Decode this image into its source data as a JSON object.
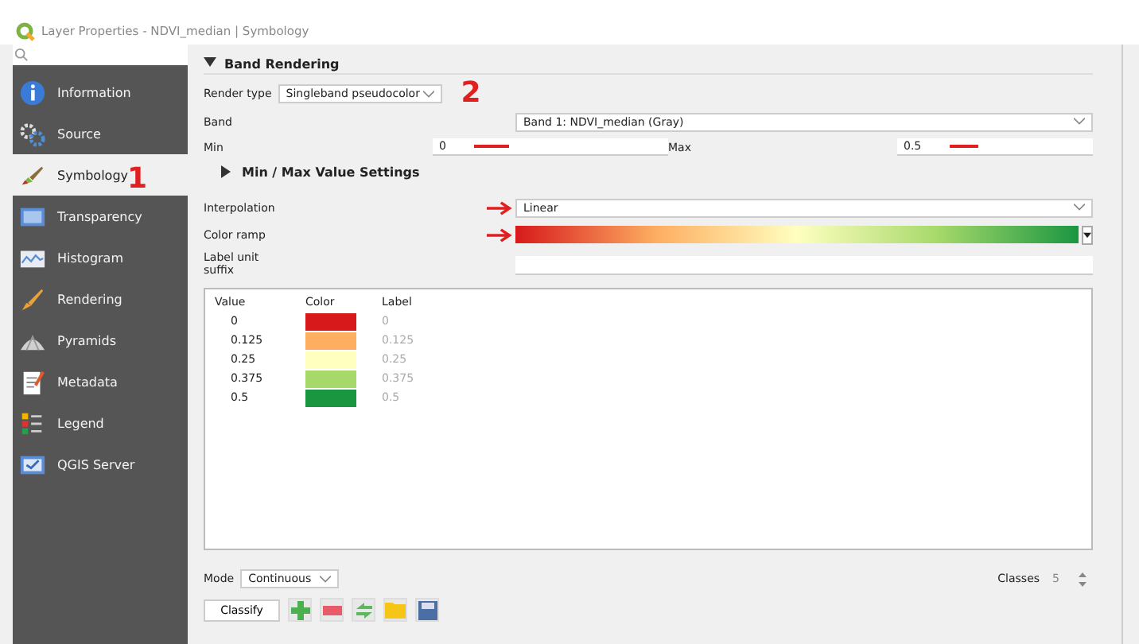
{
  "window": {
    "title": "Layer Properties - NDVI_median | Symbology"
  },
  "sidebar": {
    "items": [
      {
        "label": "Information",
        "selected": false
      },
      {
        "label": "Source",
        "selected": false
      },
      {
        "label": "Symbology",
        "selected": true
      },
      {
        "label": "Transparency",
        "selected": false
      },
      {
        "label": "Histogram",
        "selected": false
      },
      {
        "label": "Rendering",
        "selected": false
      },
      {
        "label": "Pyramids",
        "selected": false
      },
      {
        "label": "Metadata",
        "selected": false
      },
      {
        "label": "Legend",
        "selected": false
      },
      {
        "label": "QGIS Server",
        "selected": false
      }
    ]
  },
  "band_rendering": {
    "title": "Band Rendering",
    "expanded": true,
    "render_type": {
      "label": "Render type",
      "value": "Singleband pseudocolor"
    },
    "band": {
      "label": "Band",
      "value": "Band 1: NDVI_median (Gray)"
    },
    "min": {
      "label": "Min",
      "value": "0"
    },
    "max": {
      "label": "Max",
      "value": "0.5"
    },
    "minmax_settings": {
      "title": "Min / Max Value Settings",
      "expanded": false
    },
    "interpolation": {
      "label": "Interpolation",
      "value": "Linear"
    },
    "color_ramp": {
      "label": "Color ramp"
    },
    "label_unit_suffix": {
      "label": "Label unit suffix"
    },
    "table": {
      "columns": [
        "Value",
        "Color",
        "Label"
      ],
      "rows": [
        {
          "value": "0",
          "color": "#d7191c",
          "label": "0"
        },
        {
          "value": "0.125",
          "color": "#fdae61",
          "label": "0.125"
        },
        {
          "value": "0.25",
          "color": "#ffffc0",
          "label": "0.25"
        },
        {
          "value": "0.375",
          "color": "#a6d96a",
          "label": "0.375"
        },
        {
          "value": "0.5",
          "color": "#1a9641",
          "label": "0.5"
        }
      ]
    },
    "mode": {
      "label": "Mode",
      "value": "Continuous"
    },
    "classes": {
      "label": "Classes",
      "value": "5"
    },
    "classify_button": "Classify"
  },
  "annotations": [
    "1",
    "2"
  ]
}
